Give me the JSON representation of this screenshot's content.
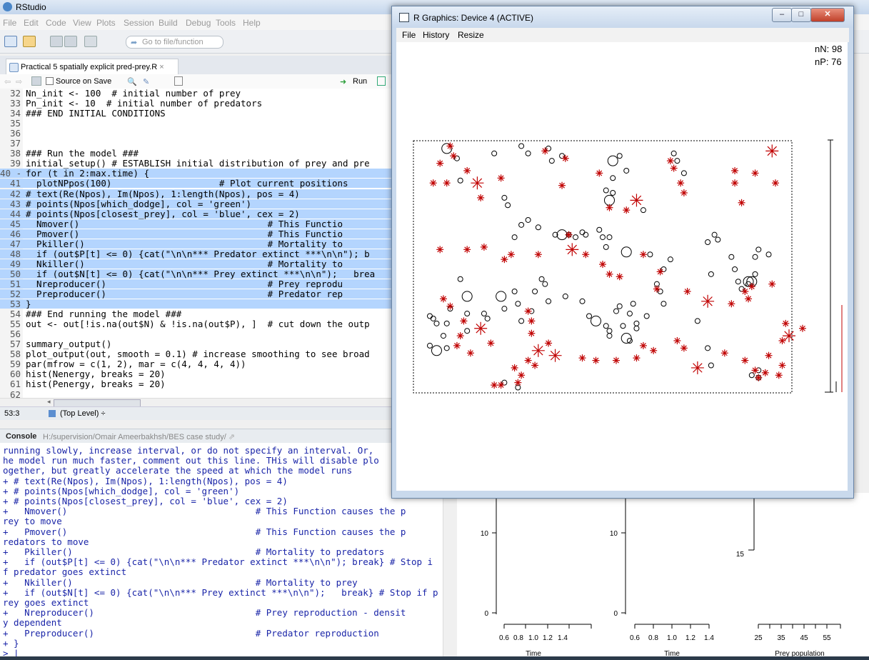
{
  "rstudio": {
    "title": "RStudio",
    "menu": [
      "File",
      "Edit",
      "Code",
      "View",
      "Plots",
      "Session",
      "Build",
      "Debug",
      "Tools",
      "Help"
    ],
    "goto_placeholder": "Go to file/function"
  },
  "source": {
    "tab_label": "Practical 5 spatially explicit pred-prey.R",
    "tab_close": "×",
    "source_on_save": "Source on Save",
    "run_label": "Run",
    "cursor_pos": "53:3",
    "scope": "(Top Level) ÷",
    "lines": [
      {
        "n": "32",
        "code": "Nn_init <- 100  # initial number of prey",
        "sel": false
      },
      {
        "n": "33",
        "code": "Pn_init <- 10  # initial number of predators",
        "sel": false
      },
      {
        "n": "34",
        "code": "### END INITIAL CONDITIONS",
        "sel": false
      },
      {
        "n": "35",
        "code": "",
        "sel": false
      },
      {
        "n": "36",
        "code": "",
        "sel": false
      },
      {
        "n": "37",
        "code": "",
        "sel": false
      },
      {
        "n": "38",
        "code": "### Run the model ###",
        "sel": false
      },
      {
        "n": "39",
        "code": "initial_setup() # ESTABLISH initial distribution of prey and pre",
        "sel": false
      },
      {
        "n": "40 -",
        "code": "for (t in 2:max.time) {",
        "sel": true
      },
      {
        "n": "41",
        "code": "  plotNPpos(100)                    # Plot current positions",
        "sel": true
      },
      {
        "n": "42",
        "code": "# text(Re(Npos), Im(Npos), 1:length(Npos), pos = 4)",
        "sel": true
      },
      {
        "n": "43",
        "code": "# points(Npos[which_dodge], col = 'green')",
        "sel": true
      },
      {
        "n": "44",
        "code": "# points(Npos[closest_prey], col = 'blue', cex = 2)",
        "sel": true
      },
      {
        "n": "45",
        "code": "  Nmover()                                   # This Functio",
        "sel": true
      },
      {
        "n": "46",
        "code": "  Pmover()                                   # This Functio",
        "sel": true
      },
      {
        "n": "47",
        "code": "  Pkiller()                                  # Mortality to",
        "sel": true
      },
      {
        "n": "48",
        "code": "  if (out$P[t] <= 0) {cat(\"\\n\\n*** Predator extinct ***\\n\\n\"); b",
        "sel": true
      },
      {
        "n": "49",
        "code": "  Nkiller()                                  # Mortality to",
        "sel": true
      },
      {
        "n": "50",
        "code": "  if (out$N[t] <= 0) {cat(\"\\n\\n*** Prey extinct ***\\n\\n\");   brea",
        "sel": true
      },
      {
        "n": "51",
        "code": "  Nreproducer()                              # Prey reprodu",
        "sel": true
      },
      {
        "n": "52",
        "code": "  Preproducer()                              # Predator rep",
        "sel": true
      },
      {
        "n": "53",
        "code": "}",
        "sel": true
      },
      {
        "n": "54",
        "code": "### End running the model ###",
        "sel": false
      },
      {
        "n": "55",
        "code": "out <- out[!is.na(out$N) & !is.na(out$P), ]  # cut down the outp",
        "sel": false
      },
      {
        "n": "56",
        "code": "",
        "sel": false
      },
      {
        "n": "57",
        "code": "summary_output()",
        "sel": false
      },
      {
        "n": "58",
        "code": "plot_output(out, smooth = 0.1) # increase smoothing to see broad",
        "sel": false
      },
      {
        "n": "59",
        "code": "par(mfrow = c(1, 2), mar = c(4, 4, 4, 4))",
        "sel": false
      },
      {
        "n": "60",
        "code": "hist(Nenergy, breaks = 20)",
        "sel": false
      },
      {
        "n": "61",
        "code": "hist(Penergy, breaks = 20)",
        "sel": false
      },
      {
        "n": "62",
        "code": "",
        "sel": false
      }
    ]
  },
  "console": {
    "title": "Console",
    "path": "H:/supervision/Omair Ameerbakhsh/BES case study/",
    "lines": [
      "running slowly, increase interval, or do not specify an interval. Or,",
      "he model run much faster, comment out this line. THis will disable plo",
      "ogether, but greatly accelerate the speed at which the model runs",
      "+ # text(Re(Npos), Im(Npos), 1:length(Npos), pos = 4)",
      "+ # points(Npos[which_dodge], col = 'green')",
      "+ # points(Npos[closest_prey], col = 'blue', cex = 2)",
      "+   Nmover()                                   # This Function causes the p",
      "rey to move",
      "+   Pmover()                                   # This Function causes the p",
      "redators to move",
      "+   Pkiller()                                  # Mortality to predators",
      "+   if (out$P[t] <= 0) {cat(\"\\n\\n*** Predator extinct ***\\n\\n\"); break} # Stop i",
      "f predator goes extinct",
      "+   Nkiller()                                  # Mortality to prey",
      "+   if (out$N[t] <= 0) {cat(\"\\n\\n*** Prey extinct ***\\n\\n\");   break} # Stop if p",
      "rey goes extinct",
      "+   Nreproducer()                              # Prey reproduction - densit",
      "y dependent",
      "+   Preproducer()                              # Predator reproduction",
      "+ }",
      "> |"
    ]
  },
  "plots": {
    "panels": [
      {
        "yticks": [
          "10",
          "0"
        ],
        "xticks": [
          "0.6",
          "0.8",
          "1.0",
          "1.2",
          "1.4"
        ],
        "xlabel": "Time"
      },
      {
        "yticks": [
          "10",
          "0"
        ],
        "xticks": [
          "0.6",
          "0.8",
          "1.0",
          "1.2",
          "1.4"
        ],
        "xlabel": "Time"
      },
      {
        "yticks": [
          "15"
        ],
        "xticks": [
          "25",
          "35",
          "45",
          "55"
        ],
        "xlabel": "Prey population"
      }
    ]
  },
  "graphics": {
    "title": "R Graphics: Device 4 (ACTIVE)",
    "menu": [
      "File",
      "History",
      "Resize"
    ],
    "nN": "nN: 98",
    "nP": "nP: 76",
    "colors": {
      "prey": "#000000",
      "predator": "#c00000"
    },
    "chart_data": {
      "type": "scatter",
      "xlim": [
        0,
        100
      ],
      "ylim": [
        0,
        100
      ],
      "series": [
        {
          "name": "nN",
          "color": "#000000",
          "marker": "open-circle",
          "points": [
            [
              9,
              98
            ],
            [
              12,
              94
            ],
            [
              13,
              85
            ],
            [
              23,
              96
            ],
            [
              31,
              99
            ],
            [
              33,
              96
            ],
            [
              39,
              98
            ],
            [
              40,
              93
            ],
            [
              43,
              95
            ],
            [
              58,
              93
            ],
            [
              60,
              95
            ],
            [
              58,
              86
            ],
            [
              62,
              89
            ],
            [
              67,
              73
            ],
            [
              76,
              96
            ],
            [
              77,
              93
            ],
            [
              79,
              88
            ],
            [
              56,
              81
            ],
            [
              57,
              77
            ],
            [
              58,
              80
            ],
            [
              26,
              78
            ],
            [
              27,
              75
            ],
            [
              31,
              67
            ],
            [
              29,
              62
            ],
            [
              33,
              69
            ],
            [
              36,
              66
            ],
            [
              41,
              63
            ],
            [
              43,
              63
            ],
            [
              45,
              63
            ],
            [
              47,
              62
            ],
            [
              49,
              64
            ],
            [
              50,
              63
            ],
            [
              54,
              65
            ],
            [
              55,
              62
            ],
            [
              56,
              58
            ],
            [
              57,
              62
            ],
            [
              62,
              56
            ],
            [
              69,
              55
            ],
            [
              73,
              49
            ],
            [
              75,
              53
            ],
            [
              93,
              54
            ],
            [
              94,
              49
            ],
            [
              95,
              44
            ],
            [
              96,
              41
            ],
            [
              98,
              43
            ],
            [
              99,
              44
            ],
            [
              100,
              47
            ],
            [
              100,
              54
            ],
            [
              101,
              57
            ],
            [
              104,
              55
            ],
            [
              86,
              60
            ],
            [
              88,
              63
            ],
            [
              89,
              61
            ],
            [
              13,
              45
            ],
            [
              15,
              38
            ],
            [
              15,
              31
            ],
            [
              9,
              27
            ],
            [
              10,
              33
            ],
            [
              5,
              29
            ],
            [
              6,
              27
            ],
            [
              8,
              22
            ],
            [
              4,
              30
            ],
            [
              4,
              18
            ],
            [
              6,
              16
            ],
            [
              9,
              17
            ],
            [
              15,
              24
            ],
            [
              20,
              31
            ],
            [
              21,
              29
            ],
            [
              26,
              33
            ],
            [
              31,
              28
            ],
            [
              34,
              32
            ],
            [
              30,
              35
            ],
            [
              25,
              38
            ],
            [
              29,
              40
            ],
            [
              35,
              40
            ],
            [
              37,
              45
            ],
            [
              38,
              43
            ],
            [
              39,
              36
            ],
            [
              44,
              38
            ],
            [
              49,
              36
            ],
            [
              51,
              30
            ],
            [
              53,
              28
            ],
            [
              56,
              26
            ],
            [
              57,
              24
            ],
            [
              57,
              22
            ],
            [
              59,
              32
            ],
            [
              60,
              34
            ],
            [
              63,
              31
            ],
            [
              65,
              27
            ],
            [
              68,
              30
            ],
            [
              62,
              21
            ],
            [
              61,
              26
            ],
            [
              65,
              25
            ],
            [
              63,
              20
            ],
            [
              71,
              43
            ],
            [
              72,
              40
            ],
            [
              73,
              35
            ],
            [
              64,
              35
            ],
            [
              87,
              47
            ],
            [
              98,
              44
            ],
            [
              83,
              28
            ],
            [
              87,
              10
            ],
            [
              86,
              17
            ],
            [
              101,
              5
            ],
            [
              101,
              8
            ],
            [
              99,
              6
            ],
            [
              26,
              3
            ],
            [
              30,
              1
            ]
          ]
        },
        {
          "name": "nP",
          "color": "#c00000",
          "marker": "asterisk",
          "points": [
            [
              10,
              99
            ],
            [
              11,
              95
            ],
            [
              7,
              92
            ],
            [
              5,
              84
            ],
            [
              9,
              84
            ],
            [
              15,
              89
            ],
            [
              18,
              84
            ],
            [
              19,
              78
            ],
            [
              25,
              86
            ],
            [
              38,
              97
            ],
            [
              43,
              83
            ],
            [
              44,
              94
            ],
            [
              54,
              88
            ],
            [
              57,
              74
            ],
            [
              62,
              73
            ],
            [
              65,
              77
            ],
            [
              75,
              93
            ],
            [
              76,
              90
            ],
            [
              78,
              84
            ],
            [
              79,
              80
            ],
            [
              94,
              89
            ],
            [
              94,
              84
            ],
            [
              96,
              76
            ],
            [
              100,
              88
            ],
            [
              105,
              97
            ],
            [
              106,
              84
            ],
            [
              7,
              57
            ],
            [
              15,
              57
            ],
            [
              20,
              58
            ],
            [
              26,
              53
            ],
            [
              28,
              55
            ],
            [
              36,
              55
            ],
            [
              45,
              63
            ],
            [
              46,
              57
            ],
            [
              50,
              55
            ],
            [
              55,
              51
            ],
            [
              57,
              47
            ],
            [
              60,
              46
            ],
            [
              67,
              55
            ],
            [
              72,
              48
            ],
            [
              71,
              41
            ],
            [
              80,
              40
            ],
            [
              86,
              36
            ],
            [
              93,
              35
            ],
            [
              97,
              40
            ],
            [
              99,
              42
            ],
            [
              98,
              37
            ],
            [
              105,
              43
            ],
            [
              8,
              37
            ],
            [
              10,
              34
            ],
            [
              14,
              28
            ],
            [
              19,
              25
            ],
            [
              13,
              22
            ],
            [
              12,
              18
            ],
            [
              16,
              15
            ],
            [
              22,
              19
            ],
            [
              33,
              32
            ],
            [
              34,
              28
            ],
            [
              34,
              23
            ],
            [
              39,
              19
            ],
            [
              41,
              14
            ],
            [
              49,
              13
            ],
            [
              53,
              12
            ],
            [
              59,
              12
            ],
            [
              65,
              13
            ],
            [
              67,
              18
            ],
            [
              70,
              16
            ],
            [
              77,
              20
            ],
            [
              79,
              17
            ],
            [
              83,
              9
            ],
            [
              91,
              15
            ],
            [
              97,
              12
            ],
            [
              100,
              8
            ],
            [
              101,
              5
            ],
            [
              103,
              7
            ],
            [
              107,
              6
            ],
            [
              108,
              10
            ],
            [
              108,
              20
            ],
            [
              110,
              22
            ],
            [
              114,
              25
            ],
            [
              109,
              27
            ],
            [
              104,
              14
            ],
            [
              23,
              2
            ],
            [
              25,
              2
            ],
            [
              29,
              9
            ],
            [
              33,
              12
            ],
            [
              31,
              6
            ],
            [
              36,
              16
            ],
            [
              35,
              10
            ],
            [
              30,
              3
            ]
          ]
        }
      ]
    }
  }
}
